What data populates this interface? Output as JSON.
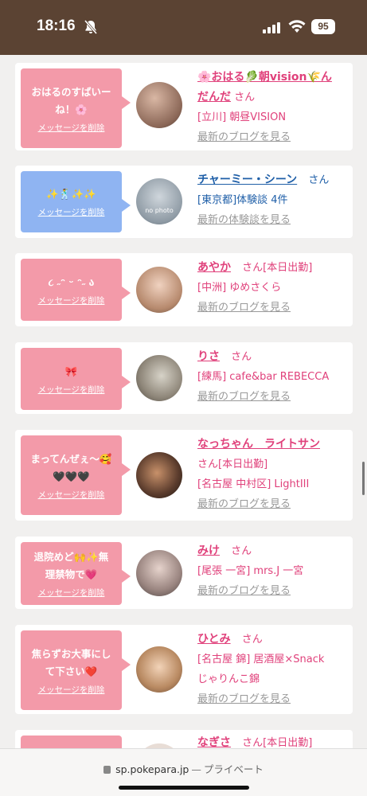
{
  "status_bar": {
    "time": "18:16",
    "battery": "95"
  },
  "browser": {
    "domain": "sp.pokepara.jp",
    "separator": "—",
    "mode": "プライベート"
  },
  "delete_label": "メッセージを削除",
  "cards": [
    {
      "message": [
        "おはるのすばいー",
        "ね！🌸"
      ],
      "name": "🌸おはる🥬朝vision🌾ん",
      "name2": "だんだ",
      "san": "さん",
      "location": "[立川] 朝昼VISION",
      "link": "最新のブログを見る"
    },
    {
      "message": [
        "✨🕺✨✨"
      ],
      "name": "チャーミー・シーン",
      "san": "さん",
      "location": "[東京都]体験談 4件",
      "link": "最新の体験談を見る",
      "avatar_text": "no photo"
    },
    {
      "message": [
        "૮ ˶ᵔ ᵕ ᵔ˶ ა"
      ],
      "name": "あやか",
      "san": "さん",
      "tag": "[本日出勤]",
      "location": "[中洲] ゆめさくら",
      "link": "最新のブログを見る"
    },
    {
      "message": [
        "🎀"
      ],
      "name": "りさ",
      "san": "さん",
      "location": "[練馬] cafe&bar REBECCA",
      "link": "最新のブログを見る"
    },
    {
      "message": [
        "まってんぜぇ〜🥰",
        "🖤🖤🖤"
      ],
      "name": "なっちゃん　ライトサン",
      "san": "さん",
      "tag": "[本日出勤]",
      "location": "[名古屋 中村区] LightIII",
      "link": "最新のブログを見る"
    },
    {
      "message": [
        "退院めど🙌✨無",
        "理禁物で💗"
      ],
      "name": "みけ",
      "san": "さん",
      "location": "[尾張 一宮] mrs.J 一宮",
      "link": "最新のブログを見る"
    },
    {
      "message": [
        "焦らずお大事にし",
        "て下さい❤️"
      ],
      "name": "ひとみ",
      "san": "さん",
      "location": "[名古屋 錦] 居酒屋×Snack",
      "location2": "じゃりんこ錦",
      "link": "最新のブログを見る"
    },
    {
      "name": "なぎさ",
      "san": "さん",
      "tag": "[本日出勤]"
    }
  ]
}
